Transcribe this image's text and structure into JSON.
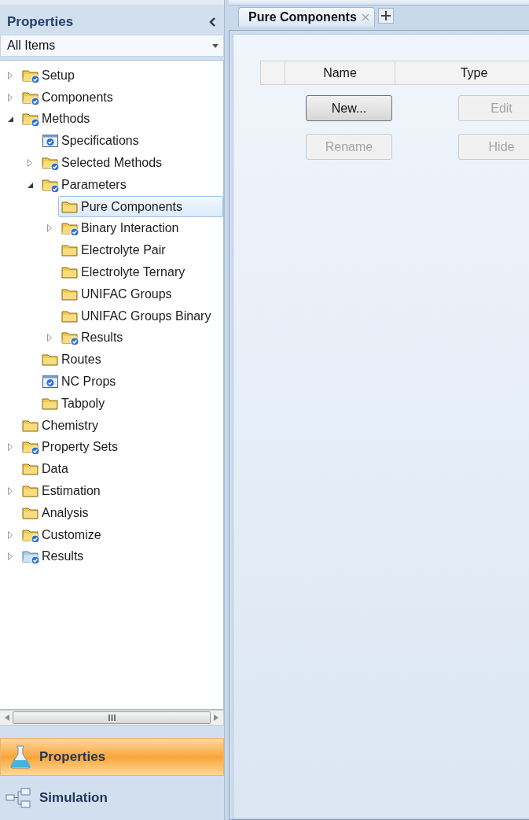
{
  "sidebar": {
    "title": "Properties",
    "filter": {
      "value": "All Items"
    },
    "tree": [
      {
        "label": "Setup",
        "kind": "folder-check",
        "expanded": false,
        "selected": false
      },
      {
        "label": "Components",
        "kind": "folder-check",
        "expanded": false,
        "selected": false
      },
      {
        "label": "Methods",
        "kind": "folder-check",
        "expanded": true,
        "selected": false,
        "children": [
          {
            "label": "Specifications",
            "kind": "form-check",
            "selected": false
          },
          {
            "label": "Selected Methods",
            "kind": "folder-check",
            "expanded": false,
            "selected": false
          },
          {
            "label": "Parameters",
            "kind": "folder-check",
            "expanded": true,
            "selected": false,
            "children": [
              {
                "label": "Pure Components",
                "kind": "folder",
                "selected": true
              },
              {
                "label": "Binary Interaction",
                "kind": "folder-check",
                "expanded": false,
                "selected": false
              },
              {
                "label": "Electrolyte Pair",
                "kind": "folder",
                "selected": false
              },
              {
                "label": "Electrolyte Ternary",
                "kind": "folder",
                "selected": false
              },
              {
                "label": "UNIFAC Groups",
                "kind": "folder",
                "selected": false
              },
              {
                "label": "UNIFAC Groups Binary",
                "kind": "folder",
                "selected": false
              },
              {
                "label": "Results",
                "kind": "folder-check",
                "expanded": false,
                "selected": false
              }
            ]
          },
          {
            "label": "Routes",
            "kind": "folder",
            "selected": false
          },
          {
            "label": "NC Props",
            "kind": "form-check",
            "selected": false
          },
          {
            "label": "Tabpoly",
            "kind": "folder",
            "selected": false
          }
        ]
      },
      {
        "label": "Chemistry",
        "kind": "folder",
        "selected": false
      },
      {
        "label": "Property Sets",
        "kind": "folder-check",
        "expanded": false,
        "selected": false
      },
      {
        "label": "Data",
        "kind": "folder",
        "selected": false
      },
      {
        "label": "Estimation",
        "kind": "folder",
        "expanded": false,
        "selected": false
      },
      {
        "label": "Analysis",
        "kind": "folder",
        "selected": false
      },
      {
        "label": "Customize",
        "kind": "folder-check",
        "expanded": false,
        "selected": false
      },
      {
        "label": "Results",
        "kind": "results-folder",
        "expanded": false,
        "selected": false
      }
    ]
  },
  "navigation": [
    {
      "label": "Properties",
      "kind": "flask",
      "selected": true
    },
    {
      "label": "Simulation",
      "kind": "flowsheet",
      "selected": false
    }
  ],
  "tabs": [
    {
      "label": "Pure Components",
      "selected": true,
      "closable": true
    }
  ],
  "form": {
    "table": {
      "columns": [
        "Name",
        "Type"
      ]
    },
    "buttons": [
      {
        "label": "New...",
        "disabled": false
      },
      {
        "label": "Edit",
        "disabled": true
      },
      {
        "label": "Rename",
        "disabled": true
      },
      {
        "label": "Hide",
        "disabled": true
      }
    ]
  }
}
